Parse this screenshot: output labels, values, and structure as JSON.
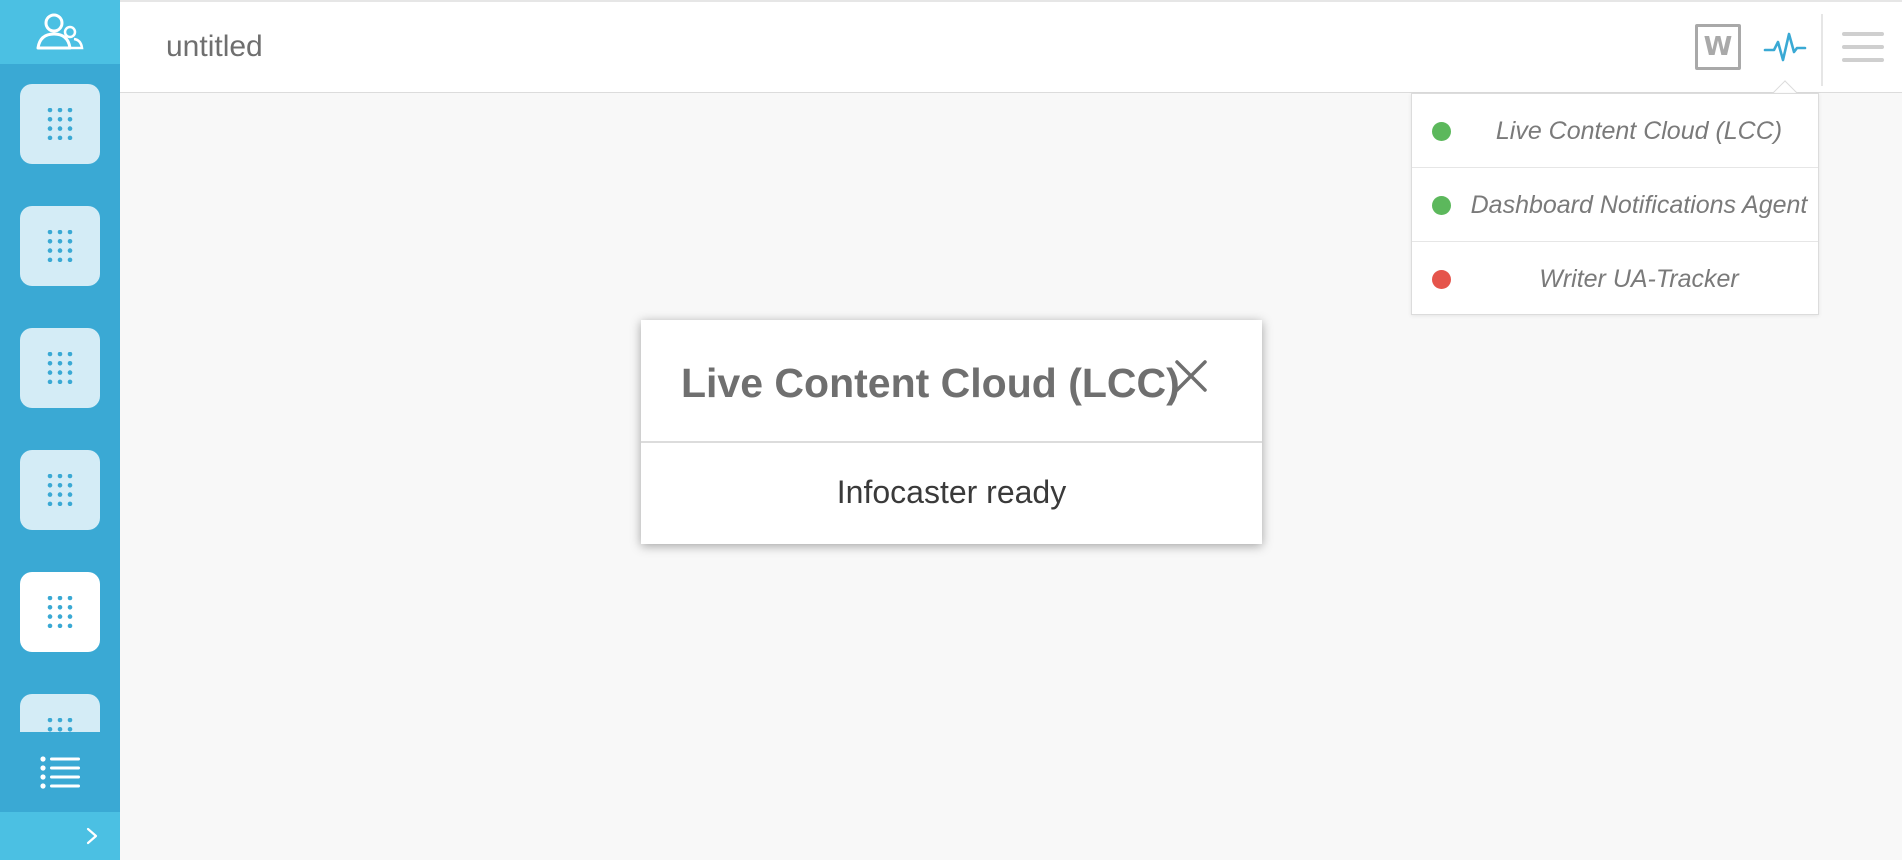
{
  "header": {
    "title": "untitled",
    "word_icon_letter": "W",
    "icons": [
      "word-icon",
      "pulse-icon",
      "menu-icon"
    ]
  },
  "sidebar": {
    "top_icon": "users-icon",
    "apps": [
      {
        "icon": "grid-icon",
        "active": false
      },
      {
        "icon": "grid-icon",
        "active": false
      },
      {
        "icon": "grid-icon",
        "active": false
      },
      {
        "icon": "grid-icon",
        "active": false
      },
      {
        "icon": "grid-icon",
        "active": true
      },
      {
        "icon": "grid-icon",
        "active": false
      }
    ],
    "list_icon": "list-icon",
    "expand_icon": "chevron-right-icon"
  },
  "status_dropdown": {
    "items": [
      {
        "label": "Live Content Cloud (LCC)",
        "status": "ok"
      },
      {
        "label": "Dashboard Notifications Agent",
        "status": "ok"
      },
      {
        "label": "Writer UA-Tracker",
        "status": "error"
      }
    ]
  },
  "modal": {
    "title": "Live Content Cloud (LCC)",
    "message": "Infocaster ready"
  },
  "colors": {
    "accent": "#3aa9d4",
    "accent_light": "#4bc0e3",
    "status_ok": "#5cb85c",
    "status_error": "#e5544b"
  }
}
